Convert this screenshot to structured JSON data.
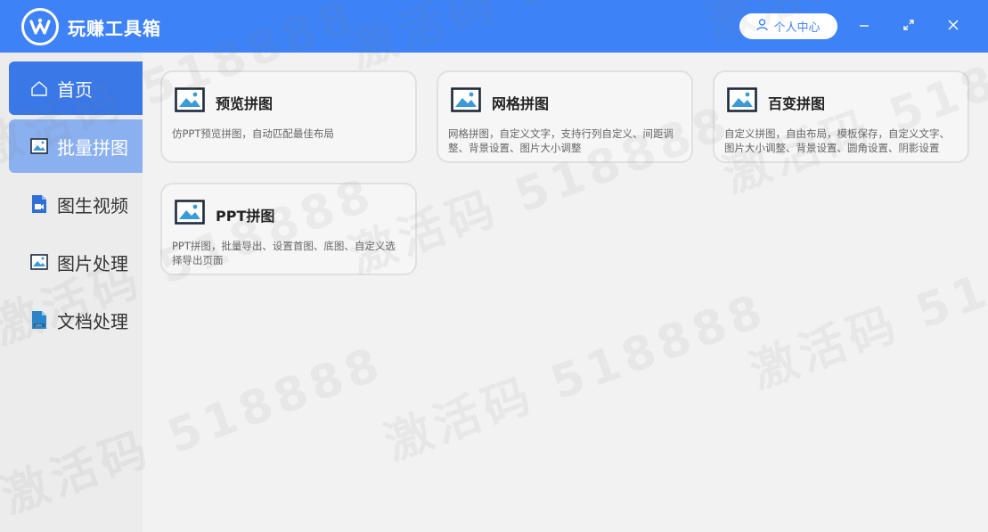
{
  "app": {
    "title": "玩赚工具箱",
    "user_center": "个人中心",
    "accent": "#3e82f7"
  },
  "sidebar": {
    "items": [
      {
        "label": "首页",
        "icon": "home-icon"
      },
      {
        "label": "批量拼图",
        "icon": "image-icon"
      },
      {
        "label": "图生视频",
        "icon": "video-file-icon"
      },
      {
        "label": "图片处理",
        "icon": "image-icon"
      },
      {
        "label": "文档处理",
        "icon": "doc-file-icon"
      }
    ]
  },
  "cards": [
    {
      "title": "预览拼图",
      "desc": "仿PPT预览拼图，自动匹配最佳布局",
      "icon": "picture-icon"
    },
    {
      "title": "网格拼图",
      "desc": "网格拼图，自定义文字，支持行列自定义、间距调整、背景设置、图片大小调整",
      "icon": "picture-icon"
    },
    {
      "title": "百变拼图",
      "desc": "自定义拼图，自由布局，模板保存，自定义文字、图片大小调整、背景设置、圆角设置、阴影设置",
      "icon": "picture-icon"
    },
    {
      "title": "PPT拼图",
      "desc": "PPT拼图，批量导出、设置首图、底图、自定义选择导出页面",
      "icon": "picture-icon"
    }
  ],
  "watermark": "激活码 518888"
}
